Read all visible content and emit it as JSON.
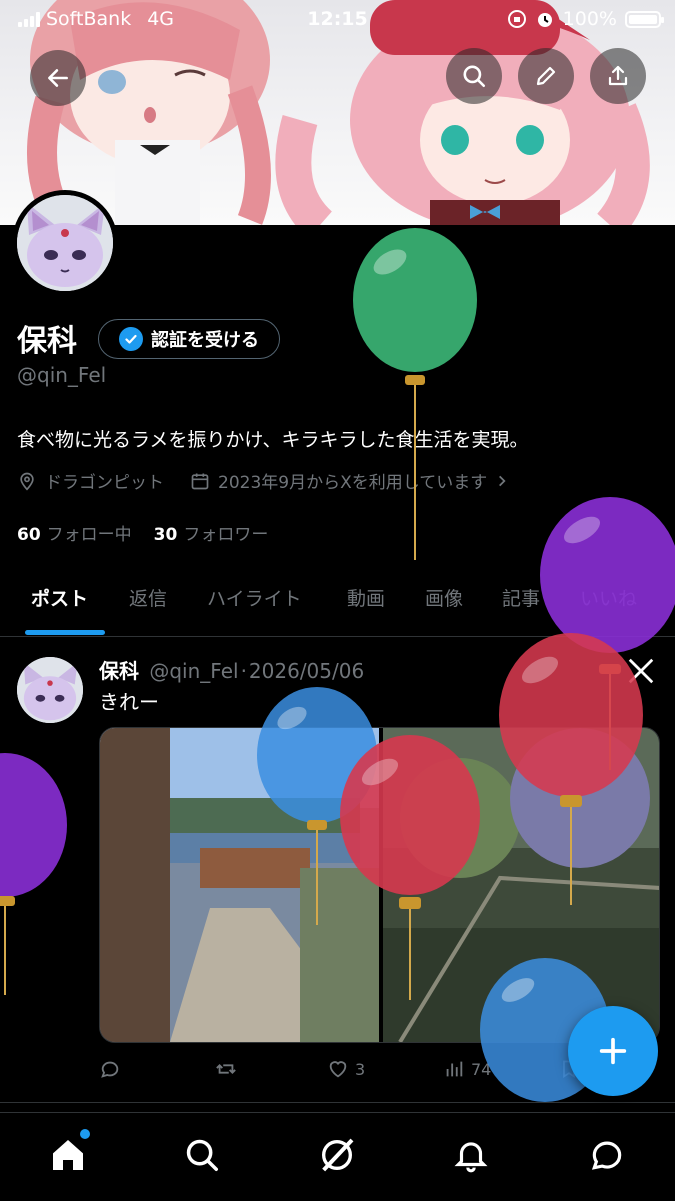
{
  "status_bar": {
    "carrier": "SoftBank",
    "network": "4G",
    "time": "12:15",
    "battery": "100%"
  },
  "profile": {
    "name": "保科",
    "verify_button": "認証を受ける",
    "handle": "@qin_Fel",
    "bio": "食べ物に光るラメを振りかけ、キラキラした食生活を実現。",
    "location": "ドラゴンピット",
    "joined": "2023年9月からXを利用しています",
    "following_count": "60",
    "following_label": "フォロー中",
    "followers_count": "30",
    "followers_label": "フォロワー"
  },
  "tabs": [
    "ポスト",
    "返信",
    "ハイライト",
    "動画",
    "画像",
    "記事",
    "いいね"
  ],
  "tweet": {
    "name": "保科",
    "handle": "@qin_Fel",
    "separator": "·",
    "date": "2026/05/06",
    "text": "きれー",
    "likes": "3",
    "views": "74"
  },
  "colors": {
    "accent": "#1d9bf0",
    "background": "#000000",
    "secondary_text": "#71767b"
  },
  "icons": [
    "back-arrow-icon",
    "search-icon",
    "edit-pencil-icon",
    "share-icon",
    "location-pin-icon",
    "calendar-icon",
    "chevron-right-icon",
    "reply-icon",
    "repost-icon",
    "like-icon",
    "views-icon",
    "x-logo-icon",
    "plus-icon",
    "home-icon",
    "grok-icon",
    "bell-icon",
    "messages-icon",
    "verified-badge-icon"
  ]
}
